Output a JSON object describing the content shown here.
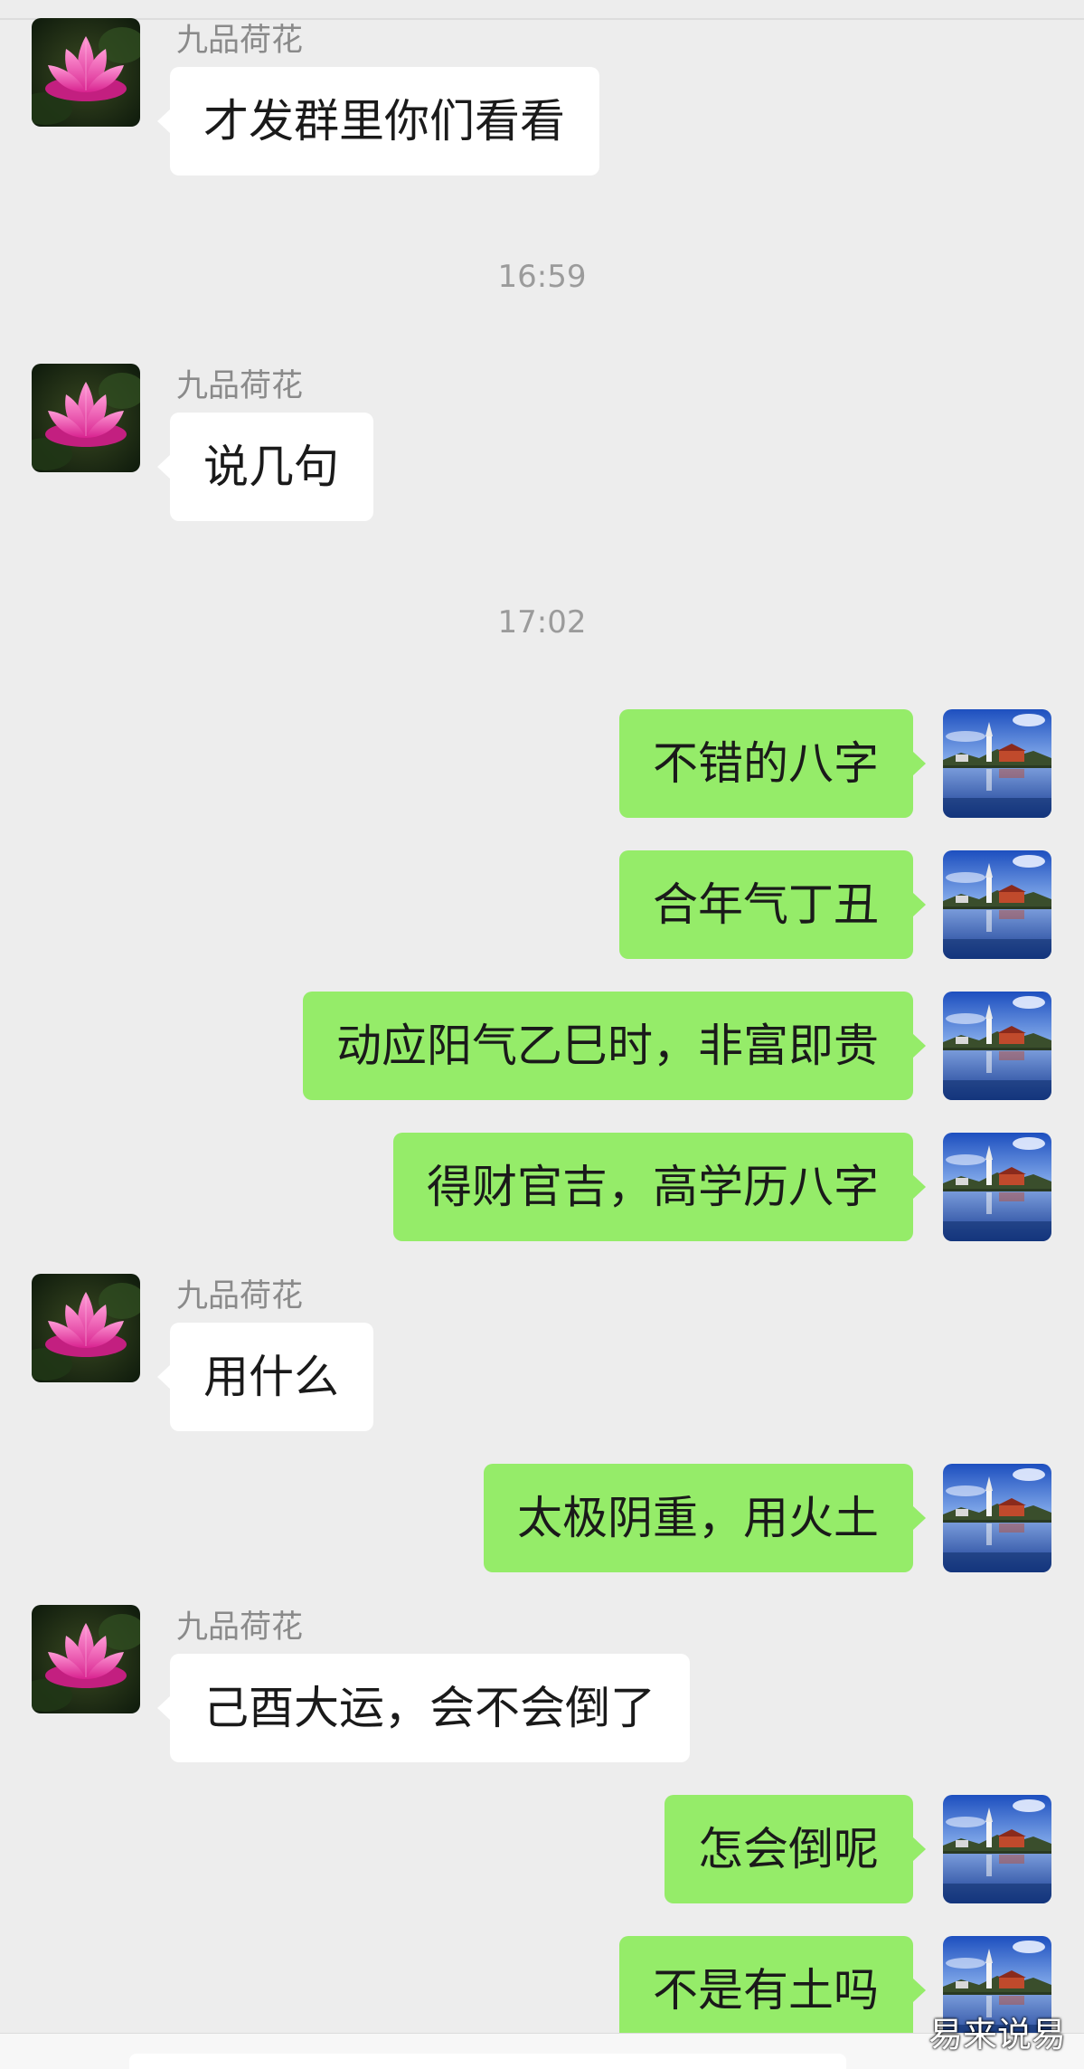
{
  "contact": {
    "name": "九品荷花",
    "avatar_icon": "lotus-flower-icon"
  },
  "self": {
    "avatar_icon": "lake-pagoda-landscape-icon"
  },
  "timestamps": [
    "16:59",
    "17:02"
  ],
  "messages": [
    {
      "from": "contact",
      "text": "才发群里你们看看"
    },
    {
      "from": "contact",
      "text": "说几句"
    },
    {
      "from": "self",
      "text": "不错的八字"
    },
    {
      "from": "self",
      "text": "合年气丁丑"
    },
    {
      "from": "self",
      "text": "动应阳气乙巳时，非富即贵"
    },
    {
      "from": "self",
      "text": "得财官吉，高学历八字"
    },
    {
      "from": "contact",
      "text": "用什么"
    },
    {
      "from": "self",
      "text": "太极阴重，用火土"
    },
    {
      "from": "contact",
      "text": "己酉大运，会不会倒了"
    },
    {
      "from": "self",
      "text": "怎会倒呢"
    },
    {
      "from": "self",
      "text": "不是有土吗"
    }
  ],
  "watermark": "易来说易",
  "colors": {
    "background": "#ededed",
    "incoming_bubble": "#ffffff",
    "outgoing_bubble": "#95ec69",
    "name_text": "#8a8a8a"
  }
}
